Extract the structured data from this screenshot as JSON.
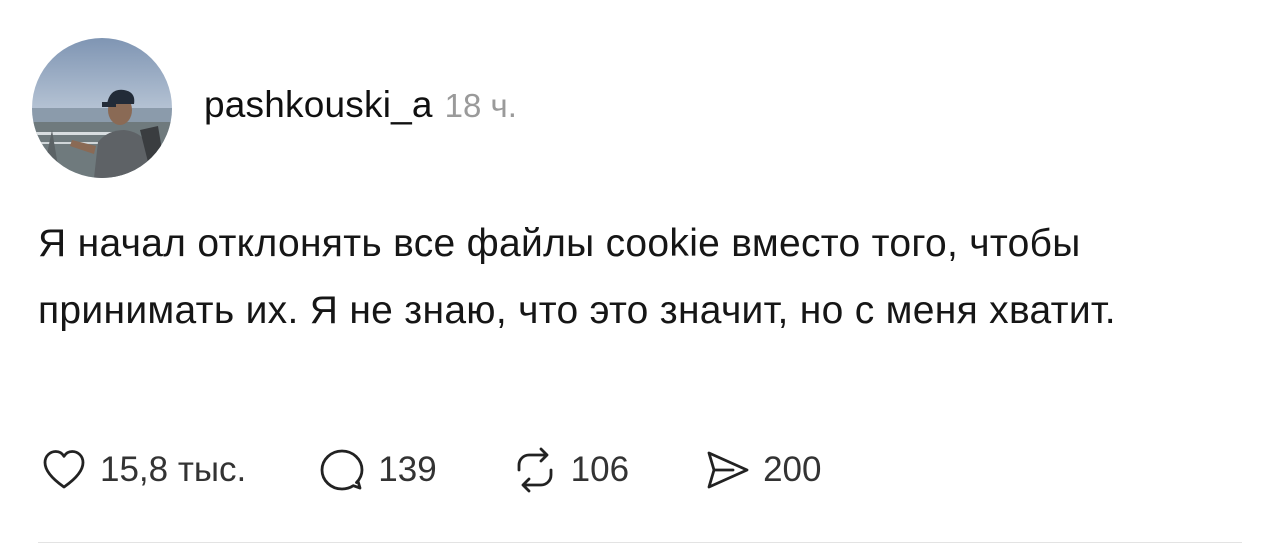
{
  "post": {
    "author": {
      "username": "pashkouski_a",
      "avatar": "avatar-photo"
    },
    "timestamp": "18 ч.",
    "text": "Я начал отклонять все файлы cookie вместо того, чтобы принимать их. Я не знаю, что это значит, но с меня хватит.",
    "actions": {
      "like": {
        "icon": "heart-icon",
        "count": "15,8 тыс."
      },
      "reply": {
        "icon": "comment-icon",
        "count": "139"
      },
      "repost": {
        "icon": "repost-icon",
        "count": "106"
      },
      "share": {
        "icon": "share-icon",
        "count": "200"
      }
    }
  },
  "colors": {
    "text": "#161616",
    "muted": "#9a9a9a",
    "icon": "#222222",
    "divider": "#e3e3e3"
  }
}
